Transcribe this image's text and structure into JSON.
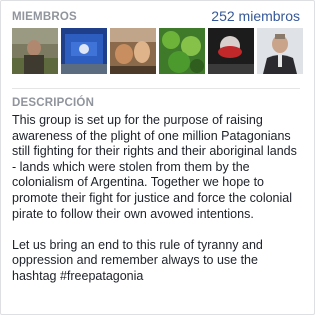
{
  "members": {
    "title": "MIEMBROS",
    "count_link": "252 miembros",
    "thumbnails": [
      {
        "icon": "member-photo-1"
      },
      {
        "icon": "member-photo-2"
      },
      {
        "icon": "member-photo-3"
      },
      {
        "icon": "member-photo-4"
      },
      {
        "icon": "member-photo-5"
      },
      {
        "icon": "member-photo-6"
      }
    ]
  },
  "description": {
    "title": "DESCRIPCIÓN",
    "paragraph1": "This group is set up for the purpose of raising awareness of the plight of one million Patagonians still fighting for their rights and their aboriginal lands - lands which were stolen from them by the colonialism of Argentina. Together we hope to promote their fight for justice and force the colonial pirate to follow their own avowed intentions.",
    "paragraph2": "Let us bring an end to this rule of tyranny and oppression and remember always to use the hashtag #freepatagonia"
  },
  "colors": {
    "link": "#365899",
    "section_title": "#90949c",
    "text": "#1d2129"
  }
}
